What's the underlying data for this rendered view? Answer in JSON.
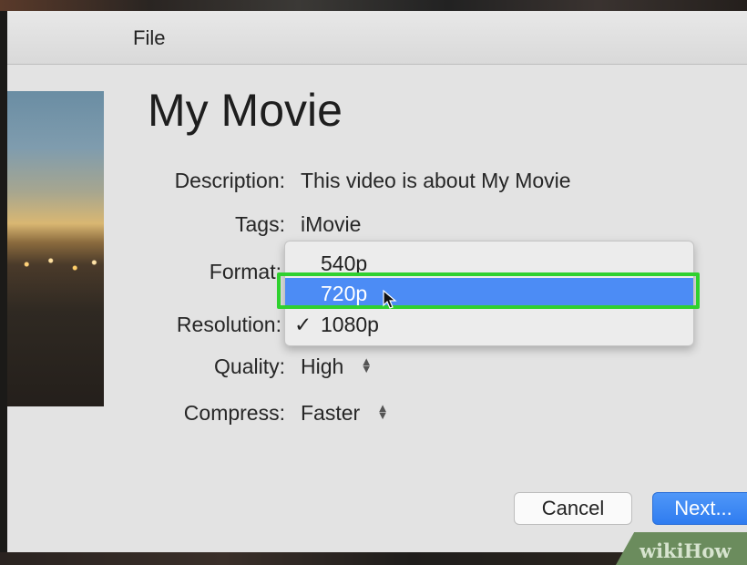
{
  "menu": {
    "file_label": "File"
  },
  "movie": {
    "title": "My Movie"
  },
  "fields": {
    "description": {
      "label": "Description:",
      "value": "This video is about My Movie"
    },
    "tags": {
      "label": "Tags:",
      "value": "iMovie"
    },
    "format": {
      "label": "Format:"
    },
    "resolution": {
      "label": "Resolution:"
    },
    "quality": {
      "label": "Quality:",
      "value": "High"
    },
    "compress": {
      "label": "Compress:",
      "value": "Faster"
    }
  },
  "resolution_menu": {
    "options": [
      "540p",
      "720p",
      "1080p"
    ],
    "highlighted": "720p",
    "checked": "1080p",
    "check_mark": "✓"
  },
  "buttons": {
    "cancel": "Cancel",
    "next": "Next..."
  },
  "watermark": {
    "text": "wikiHow"
  },
  "colors": {
    "selection": "#4c8cf5",
    "highlight_box": "#2fd12f",
    "primary_button": "#2f7cf0"
  }
}
